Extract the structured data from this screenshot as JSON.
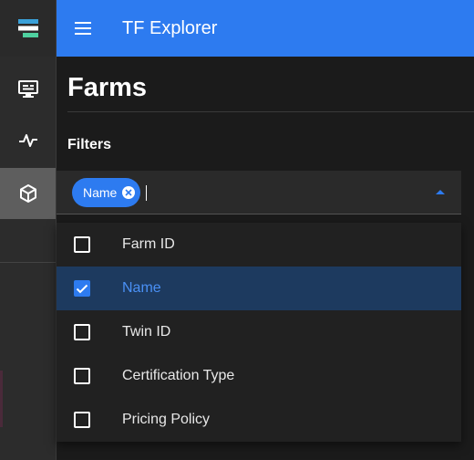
{
  "app": {
    "title": "TF Explorer",
    "accent": "#2d7bf0"
  },
  "rail": {
    "items": [
      {
        "icon": "logo-icon"
      },
      {
        "icon": "monitor-icon"
      },
      {
        "icon": "pulse-icon"
      },
      {
        "icon": "cube-icon",
        "active": true
      }
    ]
  },
  "page": {
    "title": "Farms",
    "filters_label": "Filters"
  },
  "filter_select": {
    "chips": [
      {
        "label": "Name"
      }
    ],
    "options": [
      {
        "label": "Farm ID",
        "checked": false
      },
      {
        "label": "Name",
        "checked": true
      },
      {
        "label": "Twin ID",
        "checked": false
      },
      {
        "label": "Certification Type",
        "checked": false
      },
      {
        "label": "Pricing Policy",
        "checked": false
      }
    ]
  }
}
